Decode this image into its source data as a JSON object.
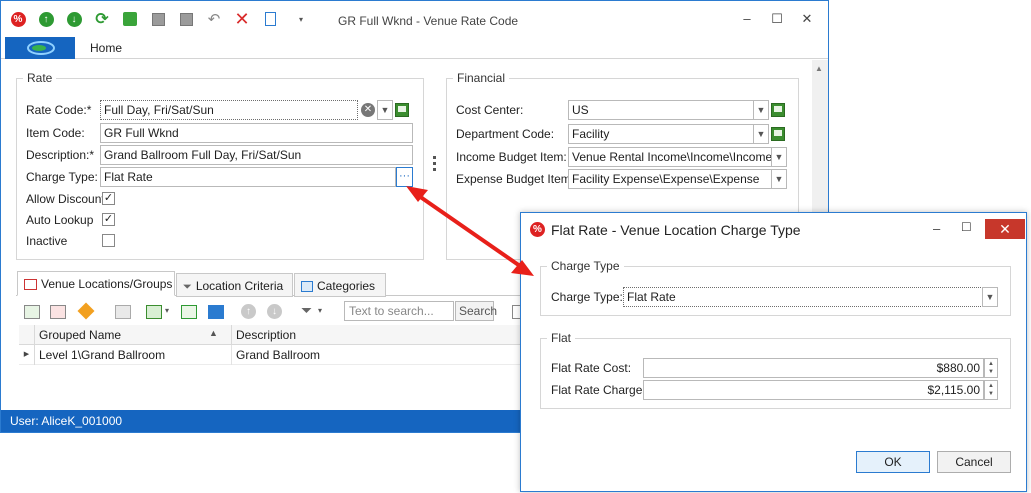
{
  "main_window": {
    "title": "GR Full Wknd - Venue Rate Code",
    "ribbon": {
      "home_tab": "Home"
    },
    "status_bar": {
      "user": "User: AliceK_001000"
    }
  },
  "rate_group": {
    "legend": "Rate",
    "rate_code": {
      "label": "Rate Code:*",
      "value": "Full Day, Fri/Sat/Sun"
    },
    "item_code": {
      "label": "Item Code:",
      "value": "GR Full Wknd"
    },
    "description": {
      "label": "Description:*",
      "value": "Grand Ballroom Full Day, Fri/Sat/Sun"
    },
    "charge_type": {
      "label": "Charge Type:",
      "value": "Flat Rate",
      "button": "···"
    },
    "allow_discount": {
      "label": "Allow Discount",
      "checked_glyph": "✓"
    },
    "auto_lookup": {
      "label": "Auto Lookup",
      "checked_glyph": "✓"
    },
    "inactive": {
      "label": "Inactive",
      "checked_glyph": ""
    }
  },
  "financial_group": {
    "legend": "Financial",
    "cost_center": {
      "label": "Cost Center:",
      "value": "US"
    },
    "department_code": {
      "label": "Department Code:",
      "value": "Facility"
    },
    "income_budget_item": {
      "label": "Income Budget Item:",
      "value": "Venue Rental Income\\Income\\Income"
    },
    "expense_budget_item": {
      "label": "Expense Budget Item:",
      "value": "Facility Expense\\Expense\\Expense"
    }
  },
  "tabs": [
    {
      "label": "Venue Locations/Groups"
    },
    {
      "label": "Location Criteria"
    },
    {
      "label": "Categories"
    }
  ],
  "grid": {
    "search_placeholder": "Text to search...",
    "search_button": "Search",
    "columns": [
      "Grouped Name",
      "Description"
    ],
    "rows": [
      {
        "grouped_name": "Level 1\\Grand Ballroom",
        "description": "Grand Ballroom"
      }
    ]
  },
  "dialog": {
    "title": "Flat Rate - Venue Location Charge Type",
    "charge_type_group": {
      "legend": "Charge Type",
      "label": "Charge Type:",
      "value": "Flat Rate"
    },
    "flat_group": {
      "legend": "Flat",
      "flat_rate_cost": {
        "label": "Flat Rate Cost:",
        "value": "$880.00"
      },
      "flat_rate_charge": {
        "label": "Flat Rate Charge:",
        "value": "$2,115.00"
      }
    },
    "ok_button": "OK",
    "cancel_button": "Cancel"
  },
  "colors": {
    "accent_blue": "#1565c0",
    "window_border": "#2b7bd0",
    "close_red": "#c7372b",
    "arrow_red": "#e8201a",
    "delete_red": "#d92b2b"
  }
}
